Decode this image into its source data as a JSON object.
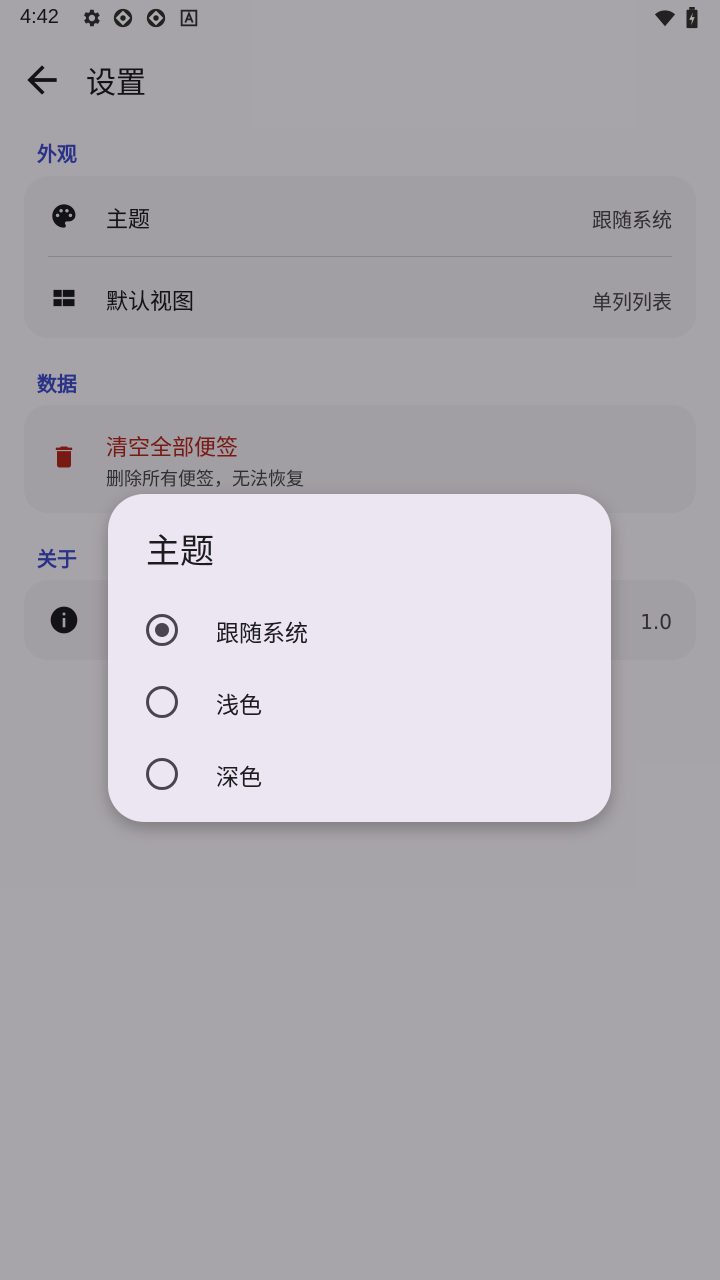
{
  "status_bar": {
    "time": "4:42",
    "icons": [
      "gear-icon",
      "app-icon",
      "app-icon",
      "font-icon",
      "wifi-icon",
      "battery-charging-icon"
    ]
  },
  "app_bar": {
    "title": "设置",
    "back_icon": "arrow-back-icon"
  },
  "sections": {
    "appearance": {
      "header": "外观",
      "theme": {
        "icon": "palette-icon",
        "label": "主题",
        "value": "跟随系统"
      },
      "default_view": {
        "icon": "grid-view-icon",
        "label": "默认视图",
        "value": "单列列表"
      }
    },
    "data": {
      "header": "数据",
      "clear_all": {
        "icon": "trash-icon",
        "label": "清空全部便签",
        "subtitle": "删除所有便签，无法恢复"
      }
    },
    "about": {
      "header": "关于",
      "version": {
        "icon": "info-icon",
        "value": "1.0"
      }
    }
  },
  "dialog": {
    "title": "主题",
    "options": [
      {
        "label": "跟随系统",
        "selected": true
      },
      {
        "label": "浅色",
        "selected": false
      },
      {
        "label": "深色",
        "selected": false
      }
    ]
  },
  "colors": {
    "accent": "#3f4ac8",
    "danger": "#b3261e",
    "surface": "#f6f2fa",
    "card": "#eee9f2",
    "dialog": "#ebe6f1"
  }
}
